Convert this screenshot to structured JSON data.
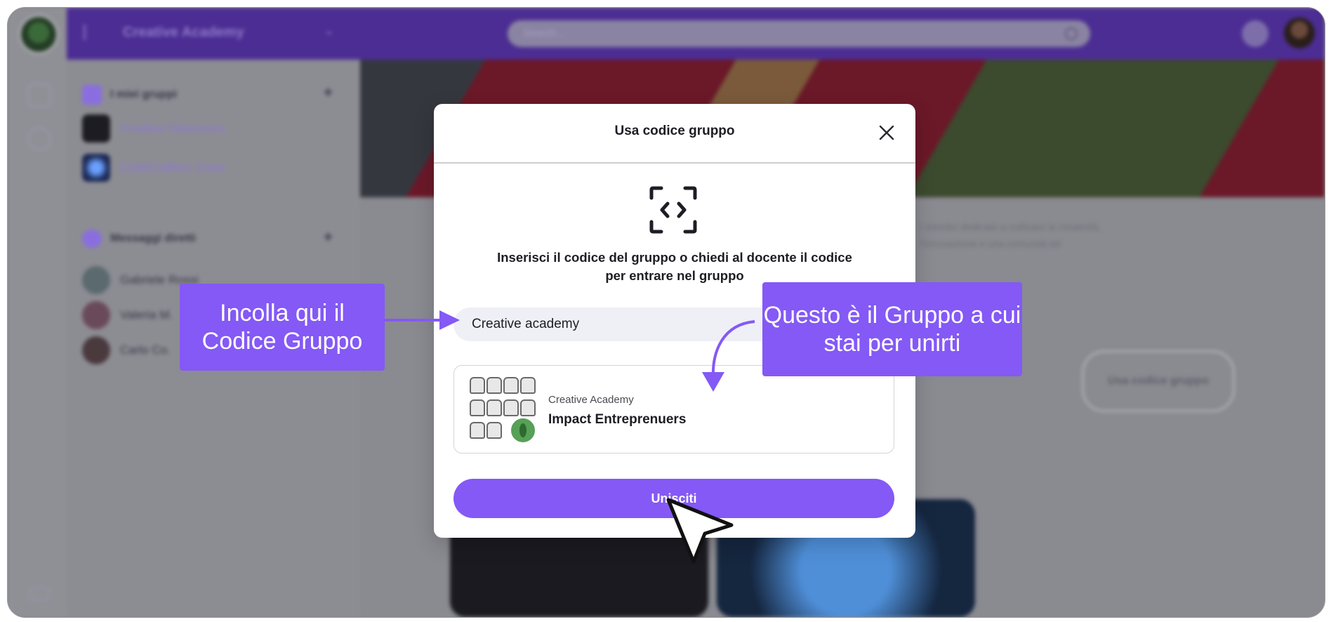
{
  "app": {
    "title": "Creative Academy",
    "search_placeholder": "Search..."
  },
  "sidebar": {
    "groups_header": "I miei gruppi",
    "groups": [
      {
        "label": "Creative Classroom"
      },
      {
        "label": "CodeCrafters' Crew"
      }
    ],
    "dm_header": "Messaggi diretti",
    "dms": [
      {
        "label": "Gabriele Rossi"
      },
      {
        "label": "Valeria M."
      },
      {
        "label": "Carlo Co."
      }
    ]
  },
  "background": {
    "description_text": "i membri dedicato a coltivare la creatività, l'innovazione e una comunità ed",
    "join_code_button": "Usa codice gruppo"
  },
  "modal": {
    "title": "Usa codice gruppo",
    "instruction": "Inserisci il codice del gruppo o chiedi al docente il codice per entrare nel gruppo",
    "code_input_value": "Creative academy",
    "group": {
      "organization": "Creative Academy",
      "name": "Impact Entreprenuers"
    },
    "join_label": "Unisciti"
  },
  "annotations": {
    "paste_code": "Incolla qui il Codice Gruppo",
    "group_info": "Questo è il Gruppo a cui stai per unirti"
  },
  "colors": {
    "accent": "#8459f5",
    "topbar": "#4c2d93",
    "overlay": "#8a8a91"
  }
}
